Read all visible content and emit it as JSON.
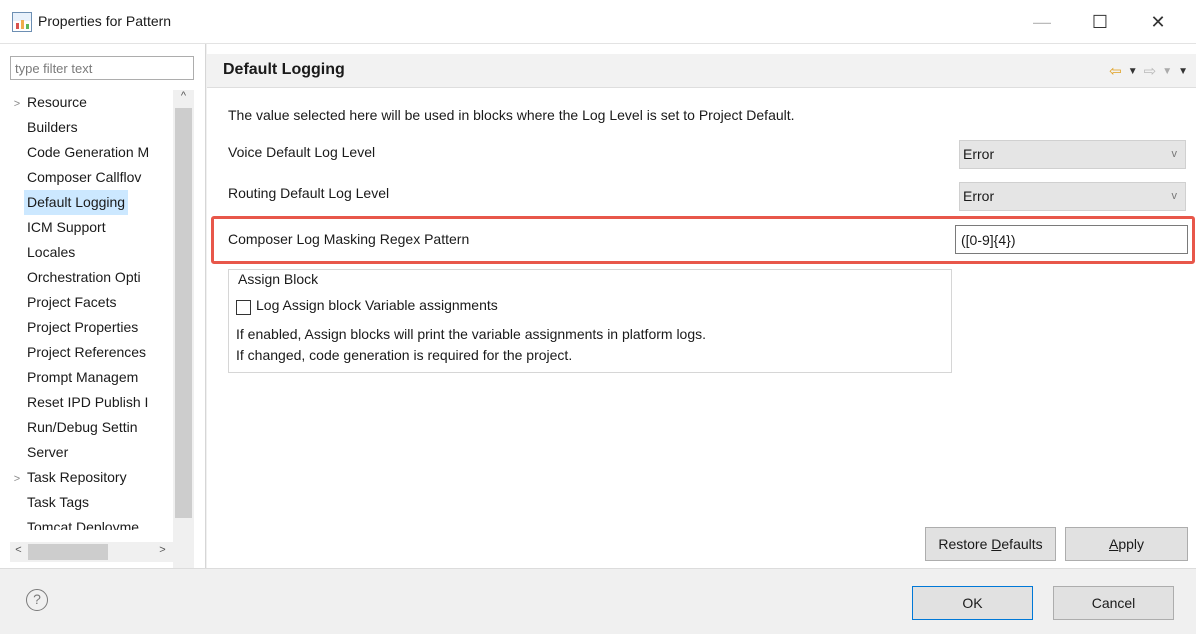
{
  "window": {
    "title": "Properties for Pattern",
    "minimize_glyph": "—",
    "maximize_glyph": "☐",
    "close_glyph": "✕"
  },
  "sidebar": {
    "filter_placeholder": "type filter text",
    "selected": "Default Logging",
    "items": [
      {
        "label": "Resource",
        "expandable": true
      },
      {
        "label": "Builders",
        "expandable": false
      },
      {
        "label": "Code Generation M",
        "expandable": false
      },
      {
        "label": "Composer Callflov",
        "expandable": false
      },
      {
        "label": "Default Logging",
        "expandable": false
      },
      {
        "label": "ICM Support",
        "expandable": false
      },
      {
        "label": "Locales",
        "expandable": false
      },
      {
        "label": "Orchestration Opti",
        "expandable": false
      },
      {
        "label": "Project Facets",
        "expandable": false
      },
      {
        "label": "Project Properties",
        "expandable": false
      },
      {
        "label": "Project References",
        "expandable": false
      },
      {
        "label": "Prompt Managem",
        "expandable": false
      },
      {
        "label": "Reset IPD Publish I",
        "expandable": false
      },
      {
        "label": "Run/Debug Settin",
        "expandable": false
      },
      {
        "label": "Server",
        "expandable": false
      },
      {
        "label": "Task Repository",
        "expandable": true
      },
      {
        "label": "Task Tags",
        "expandable": false
      },
      {
        "label": "Tomcat Deployme",
        "expandable": false
      }
    ]
  },
  "page": {
    "title": "Default Logging",
    "description": "The value selected here will be used in blocks where the Log Level is set to Project Default.",
    "voice_label": "Voice Default Log Level",
    "voice_value": "Error",
    "routing_label": "Routing Default Log Level",
    "routing_value": "Error",
    "regex_label": "Composer Log Masking Regex Pattern",
    "regex_value": "([0-9]{4})",
    "assign_group": {
      "title": "Assign Block",
      "checkbox_label": "Log Assign block Variable assignments",
      "checked": false,
      "help_line_1": "If enabled, Assign blocks will print the variable assignments in platform logs.",
      "help_line_2": "If changed, code generation is required for the project."
    },
    "restore_pre": "Restore ",
    "restore_mnemonic": "D",
    "restore_post": "efaults",
    "apply_mnemonic": "A",
    "apply_post": "pply"
  },
  "footer": {
    "help_glyph": "?",
    "ok_label": "OK",
    "cancel_label": "Cancel"
  },
  "colors": {
    "highlight": "#e8574a",
    "selection": "#cce8ff",
    "ok_border": "#0078d7"
  }
}
